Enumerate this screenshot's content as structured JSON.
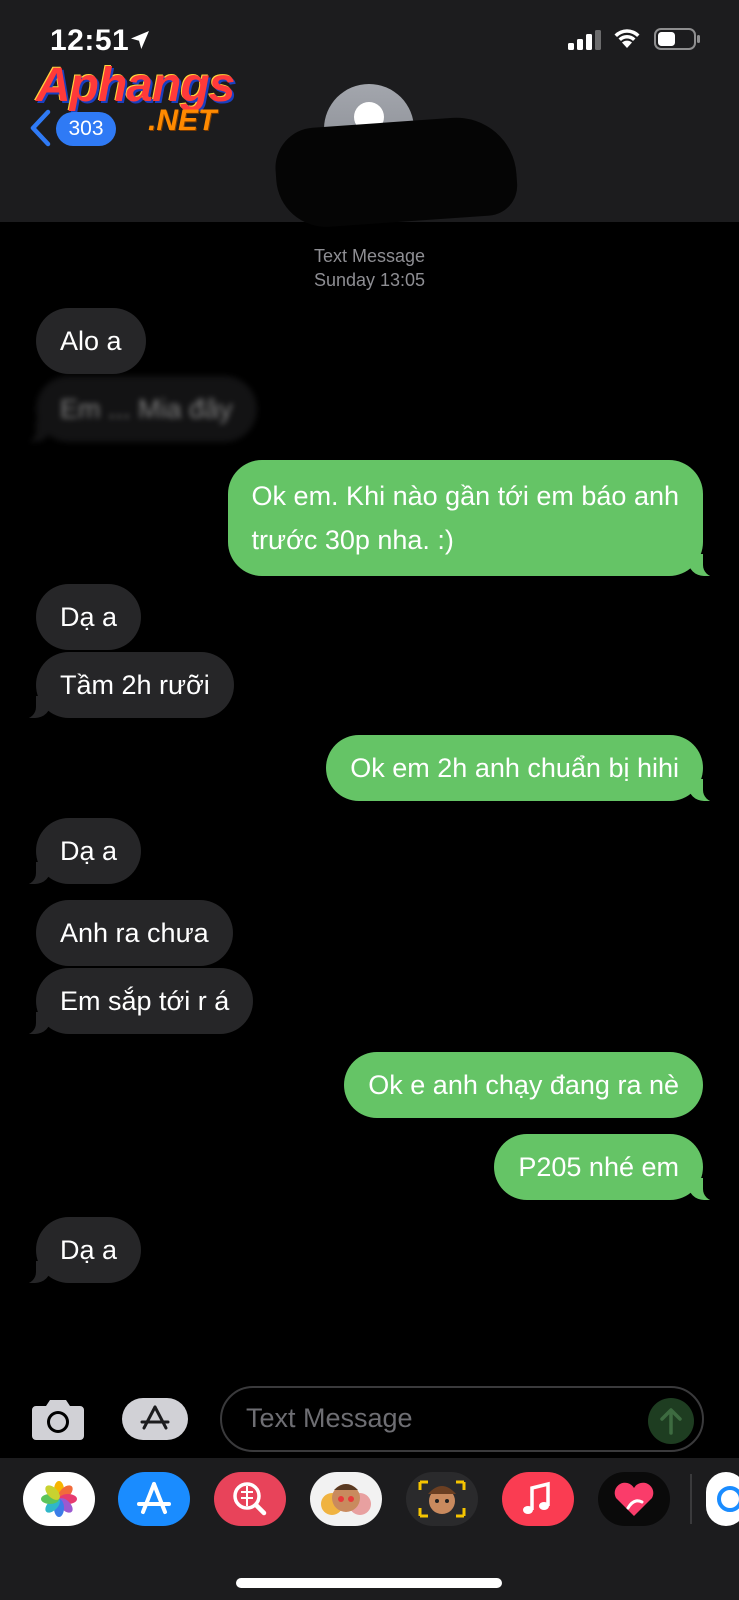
{
  "status_bar": {
    "time": "12:51"
  },
  "watermark": {
    "main": "Aphangs",
    "suffix": ".NET"
  },
  "nav": {
    "back_count": "303"
  },
  "thread": {
    "service": "Text Message",
    "timestamp": "Sunday 13:05"
  },
  "messages": [
    {
      "from": "them",
      "text": "Alo a"
    },
    {
      "from": "them",
      "text": "Em ... Mia đây",
      "obscured": true
    },
    {
      "from": "me",
      "lines": [
        "Ok em. Khi nào gần tới em báo anh",
        "trước 30p nha. :)"
      ]
    },
    {
      "from": "them",
      "text": "Dạ a"
    },
    {
      "from": "them",
      "text": "Tầm 2h rưỡi"
    },
    {
      "from": "me",
      "text": "Ok em 2h anh chuẩn bị hihi"
    },
    {
      "from": "them",
      "text": "Dạ a"
    },
    {
      "from": "them",
      "text": "Anh ra chưa"
    },
    {
      "from": "them",
      "text": "Em sắp tới r á"
    },
    {
      "from": "me",
      "text": "Ok e anh chạy đang ra nè"
    },
    {
      "from": "me",
      "text": "P205 nhé em"
    },
    {
      "from": "them",
      "text": "Dạ a"
    }
  ],
  "composer": {
    "placeholder": "Text Message"
  },
  "app_drawer": {
    "apps": [
      {
        "icon": "photos-icon",
        "color": "#ffffff"
      },
      {
        "icon": "app-store-icon",
        "color": "#1a8cff"
      },
      {
        "icon": "image-search-icon",
        "color": "#e8435a"
      },
      {
        "icon": "memoji-stickers-icon",
        "color": "#f2f2f2"
      },
      {
        "icon": "memoji-icon",
        "color": "#2a2a2c"
      },
      {
        "icon": "music-icon",
        "color": "#fa3c52"
      },
      {
        "icon": "digital-touch-icon",
        "color": "#0a0a0a"
      }
    ]
  },
  "colors": {
    "incoming": "#262628",
    "outgoing": "#65c466",
    "background": "#000000",
    "header": "#1c1c1e"
  }
}
